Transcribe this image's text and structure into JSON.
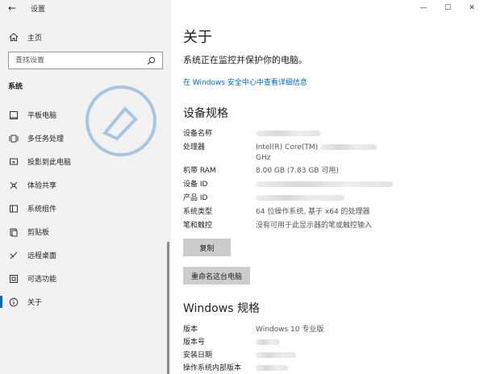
{
  "window": {
    "app_title": "设置",
    "back_glyph": "←",
    "minimize_glyph": "—",
    "maximize_glyph": "☐",
    "close_glyph": "✕"
  },
  "sidebar": {
    "home_label": "主页",
    "search_placeholder": "查找设置",
    "section_title": "系统",
    "items": [
      {
        "label": "平板电脑",
        "icon": "tablet-icon"
      },
      {
        "label": "多任务处理",
        "icon": "multitask-icon"
      },
      {
        "label": "投影到此电脑",
        "icon": "project-icon"
      },
      {
        "label": "体验共享",
        "icon": "share-icon"
      },
      {
        "label": "系统组件",
        "icon": "component-icon"
      },
      {
        "label": "剪贴板",
        "icon": "clipboard-icon"
      },
      {
        "label": "远程桌面",
        "icon": "remote-icon"
      },
      {
        "label": "可选功能",
        "icon": "optional-icon"
      },
      {
        "label": "关于",
        "icon": "info-icon",
        "active": true
      }
    ]
  },
  "main": {
    "title": "关于",
    "subtitle": "系统正在监控并保护你的电脑。",
    "security_link": "在 Windows 安全中心中查看详细信息",
    "device_spec_title": "设备规格",
    "device_specs": {
      "device_name": {
        "key": "设备名称"
      },
      "processor": {
        "key": "处理器",
        "value": "Intel(R) Core(TM)",
        "value_line2": "GHz"
      },
      "ram": {
        "key": "机带 RAM",
        "value": "8.00 GB (7.83 GB 可用)"
      },
      "device_id": {
        "key": "设备 ID"
      },
      "product_id": {
        "key": "产品 ID"
      },
      "system_type": {
        "key": "系统类型",
        "value": "64 位操作系统, 基于 x64 的处理器"
      },
      "pen_touch": {
        "key": "笔和触控",
        "value": "没有可用于此显示器的笔或触控输入"
      }
    },
    "copy_button": "复制",
    "rename_button": "重命名这台电脑",
    "windows_spec_title": "Windows 规格",
    "windows_specs": {
      "edition": {
        "key": "版本",
        "value": "Windows 10 专业版"
      },
      "version": {
        "key": "版本号"
      },
      "install_date": {
        "key": "安装日期"
      },
      "os_build": {
        "key": "操作系统内部版本"
      }
    }
  },
  "colors": {
    "accent": "#0067c0",
    "sidebar_bg": "#f2f2f2",
    "button_bg": "#cccccc"
  }
}
